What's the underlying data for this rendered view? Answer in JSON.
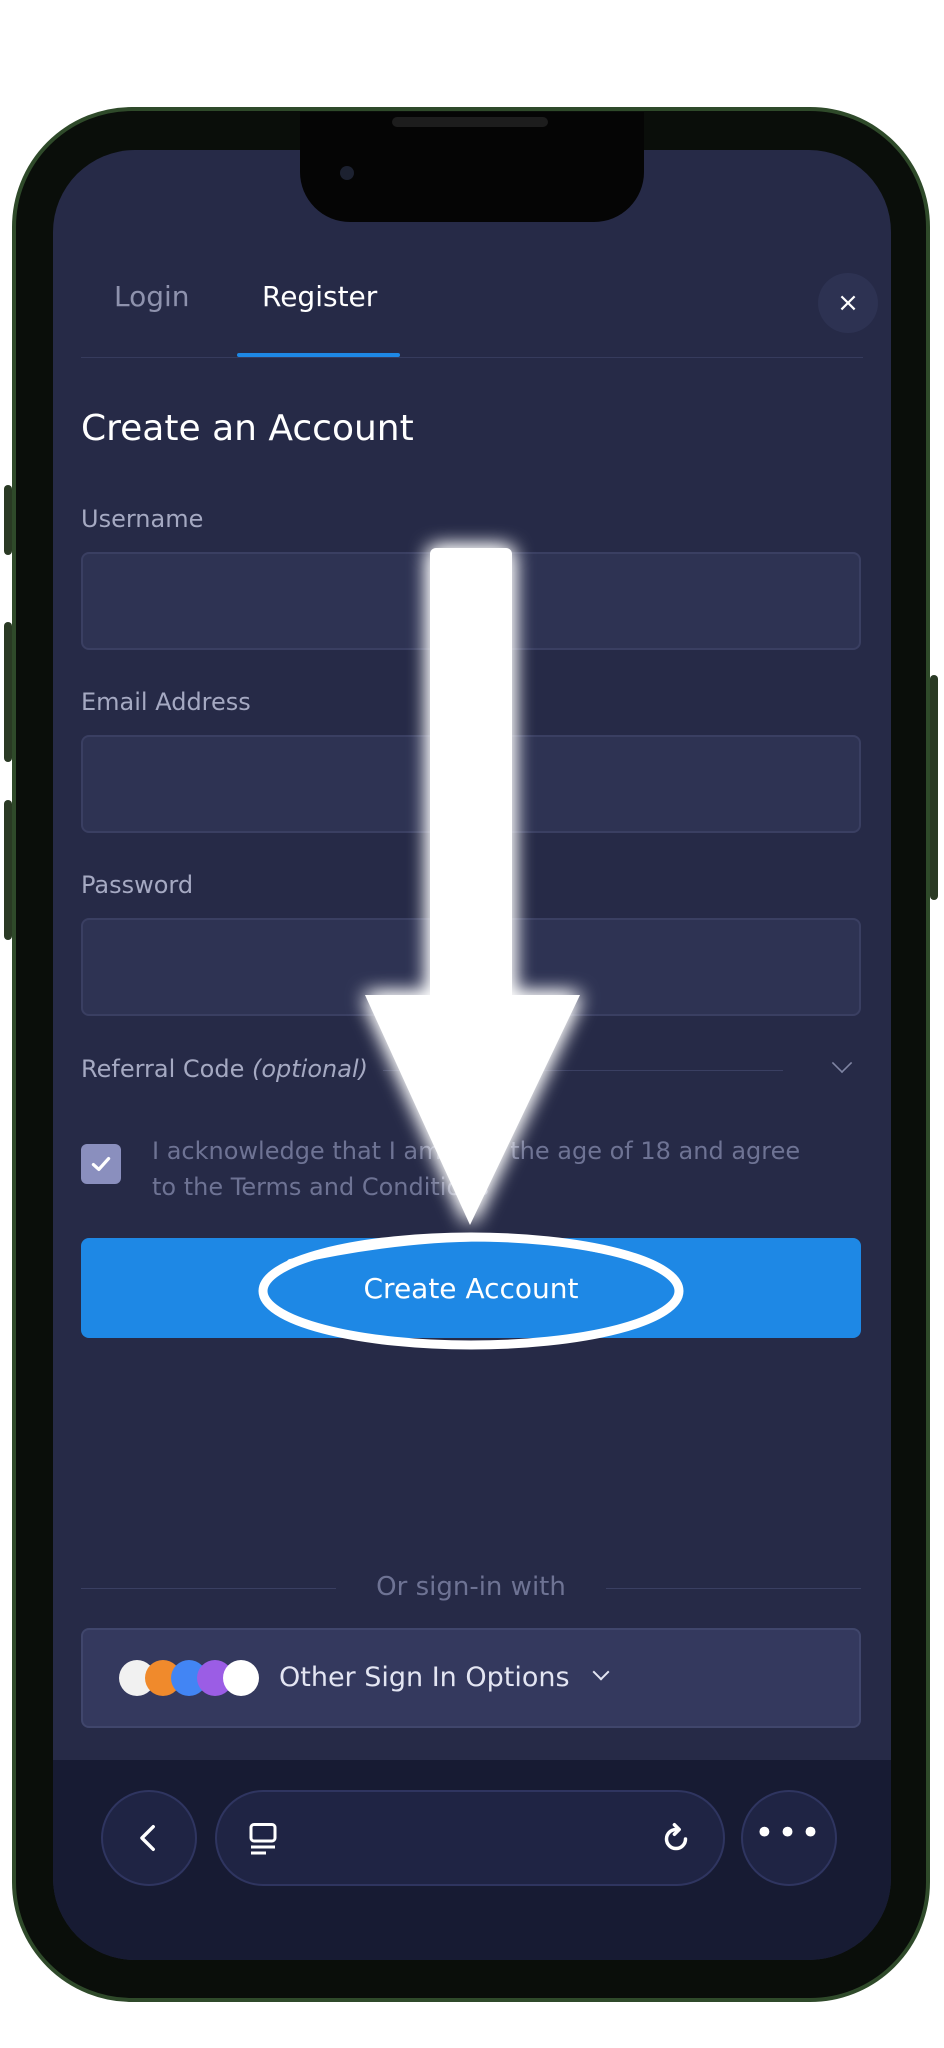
{
  "tabs": {
    "login": "Login",
    "register": "Register"
  },
  "close_icon": "×",
  "form": {
    "title": "Create an Account",
    "username_label": "Username",
    "email_label": "Email Address",
    "password_label": "Password",
    "referral_label": "Referral Code",
    "referral_optional": "(optional)",
    "acknowledgement": "I acknowledge that I am over the age of 18 and agree to the Terms and Conditions",
    "acknowledged": true,
    "submit_label": "Create Account"
  },
  "alt_signin": {
    "divider_text": "Or sign-in with",
    "button_label": "Other Sign In Options",
    "provider_logos": [
      "steam-logo",
      "metamask-logo",
      "google-logo",
      "twitch-logo",
      "discord-logo"
    ]
  },
  "browser": {
    "back_icon": "chevron-left-icon",
    "tabs_icon": "tabs-icon",
    "reload_icon": "reload-icon",
    "more_icon": "more-icon"
  },
  "colors": {
    "accent": "#1e88e5",
    "background": "#262a47",
    "annotation": "#ffffff"
  }
}
